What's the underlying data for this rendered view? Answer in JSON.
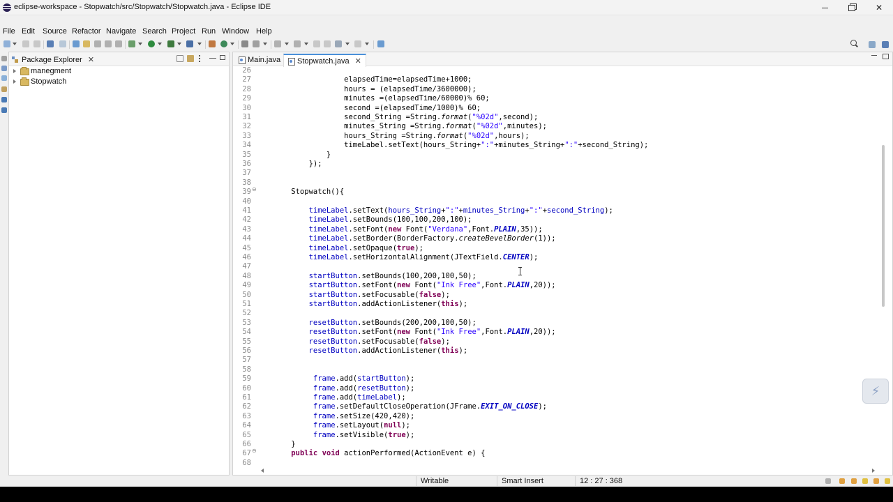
{
  "window": {
    "title": "eclipse-workspace - Stopwatch/src/Stopwatch/Stopwatch.java - Eclipse IDE",
    "close_glyph": "✕"
  },
  "menu": [
    "File",
    "Edit",
    "Source",
    "Refactor",
    "Navigate",
    "Search",
    "Project",
    "Run",
    "Window",
    "Help"
  ],
  "package_explorer": {
    "title": "Package Explorer",
    "projects": [
      "manegment",
      "Stopwatch"
    ]
  },
  "editor": {
    "tabs": [
      "Main.java",
      "Stopwatch.java"
    ],
    "active_tab": "Stopwatch.java",
    "lines": [
      {
        "n": "26",
        "html": ""
      },
      {
        "n": "27",
        "html": "                elapsedTime=elapsedTime+1000;"
      },
      {
        "n": "28",
        "html": "                hours = (elapsedTime/3600000);"
      },
      {
        "n": "29",
        "html": "                minutes =(elapsedTime/60000)% 60;"
      },
      {
        "n": "30",
        "html": "                second =(elapsedTime/1000)% 60;"
      },
      {
        "n": "31",
        "html": "                second_String =String.<span class=\"it\">format</span>(<span class=\"str\">\"%02d\"</span>,second);"
      },
      {
        "n": "32",
        "html": "                minutes_String =String.<span class=\"it\">format</span>(<span class=\"str\">\"%02d\"</span>,minutes);"
      },
      {
        "n": "33",
        "html": "                hours_String =String.<span class=\"it\">format</span>(<span class=\"str\">\"%02d\"</span>,hours);"
      },
      {
        "n": "34",
        "html": "                timeLabel.setText(hours_String+<span class=\"str\">\":\"</span>+minutes_String+<span class=\"str\">\":\"</span>+second_String);"
      },
      {
        "n": "35",
        "html": "            }"
      },
      {
        "n": "36",
        "html": "        });"
      },
      {
        "n": "37",
        "html": ""
      },
      {
        "n": "38",
        "html": ""
      },
      {
        "n": "39",
        "html": "    Stopwatch(){",
        "fold": true
      },
      {
        "n": "40",
        "html": ""
      },
      {
        "n": "41",
        "html": "        <span class=\"fld\">timeLabel</span>.setText(<span class=\"fld\">hours_String</span>+<span class=\"str\">\":\"</span>+<span class=\"fld\">minutes_String</span>+<span class=\"str\">\":\"</span>+<span class=\"fld\">second_String</span>);"
      },
      {
        "n": "42",
        "html": "        <span class=\"fld\">timeLabel</span>.setBounds(100,100,200,100);"
      },
      {
        "n": "43",
        "html": "        <span class=\"fld\">timeLabel</span>.setFont(<span class=\"kw\">new</span> Font(<span class=\"str\">\"Verdana\"</span>,Font.<span class=\"sf\">PLAIN</span>,35));"
      },
      {
        "n": "44",
        "html": "        <span class=\"fld\">timeLabel</span>.setBorder(BorderFactory.<span class=\"it\">createBevelBorder</span>(1));"
      },
      {
        "n": "45",
        "html": "        <span class=\"fld\">timeLabel</span>.setOpaque(<span class=\"kw\">true</span>);"
      },
      {
        "n": "46",
        "html": "        <span class=\"fld\">timeLabel</span>.setHorizontalAlignment(JTextField.<span class=\"sf\">CENTER</span>);"
      },
      {
        "n": "47",
        "html": ""
      },
      {
        "n": "48",
        "html": "        <span class=\"fld\">startButton</span>.setBounds(100,200,100,50);"
      },
      {
        "n": "49",
        "html": "        <span class=\"fld\">startButton</span>.setFont(<span class=\"kw\">new</span> Font(<span class=\"str\">\"Ink Free\"</span>,Font.<span class=\"sf\">PLAIN</span>,20));"
      },
      {
        "n": "50",
        "html": "        <span class=\"fld\">startButton</span>.setFocusable(<span class=\"kw\">false</span>);"
      },
      {
        "n": "51",
        "html": "        <span class=\"fld\">startButton</span>.addActionListener(<span class=\"kw\">this</span>);"
      },
      {
        "n": "52",
        "html": ""
      },
      {
        "n": "53",
        "html": "        <span class=\"fld\">resetButton</span>.setBounds(200,200,100,50);"
      },
      {
        "n": "54",
        "html": "        <span class=\"fld\">resetButton</span>.setFont(<span class=\"kw\">new</span> Font(<span class=\"str\">\"Ink Free\"</span>,Font.<span class=\"sf\">PLAIN</span>,20));"
      },
      {
        "n": "55",
        "html": "        <span class=\"fld\">resetButton</span>.setFocusable(<span class=\"kw\">false</span>);"
      },
      {
        "n": "56",
        "html": "        <span class=\"fld\">resetButton</span>.addActionListener(<span class=\"kw\">this</span>);"
      },
      {
        "n": "57",
        "html": ""
      },
      {
        "n": "58",
        "html": ""
      },
      {
        "n": "59",
        "html": "         <span class=\"fld\">frame</span>.add(<span class=\"fld\">startButton</span>);"
      },
      {
        "n": "60",
        "html": "         <span class=\"fld\">frame</span>.add(<span class=\"fld\">resetButton</span>);"
      },
      {
        "n": "61",
        "html": "         <span class=\"fld\">frame</span>.add(<span class=\"fld\">timeLabel</span>);"
      },
      {
        "n": "62",
        "html": "         <span class=\"fld\">frame</span>.setDefaultCloseOperation(JFrame.<span class=\"sf\">EXIT_ON_CLOSE</span>);"
      },
      {
        "n": "63",
        "html": "         <span class=\"fld\">frame</span>.setSize(420,420);"
      },
      {
        "n": "64",
        "html": "         <span class=\"fld\">frame</span>.setLayout(<span class=\"kw\">null</span>);"
      },
      {
        "n": "65",
        "html": "         <span class=\"fld\">frame</span>.setVisible(<span class=\"kw\">true</span>);"
      },
      {
        "n": "66",
        "html": "    }"
      },
      {
        "n": "67",
        "html": "    <span class=\"kw\">public</span> <span class=\"kw\">void</span> actionPerformed(ActionEvent e) {",
        "fold": true
      },
      {
        "n": "68",
        "html": ""
      }
    ]
  },
  "status": {
    "writable": "Writable",
    "insert_mode": "Smart Insert",
    "position": "12 : 27 : 368"
  },
  "colors": {
    "keyword": "#7f0055",
    "string": "#2a00ff",
    "field": "#0000c0"
  }
}
